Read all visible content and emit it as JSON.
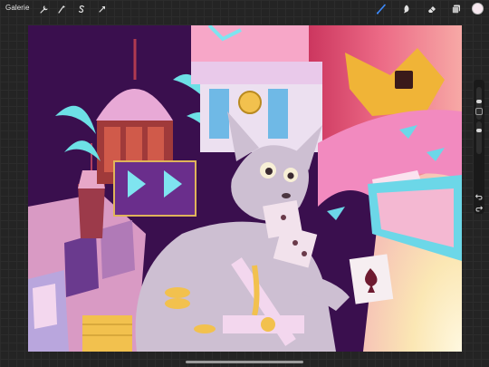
{
  "app": {
    "gallery_label": "Galerie"
  },
  "left_tools": [
    {
      "name": "wrench-icon"
    },
    {
      "name": "adjustments-wand-icon"
    },
    {
      "name": "selection-s-icon"
    },
    {
      "name": "transform-arrow-icon"
    }
  ],
  "right_tools": [
    {
      "name": "brush-icon",
      "active": true
    },
    {
      "name": "smudge-icon",
      "active": false
    },
    {
      "name": "eraser-icon",
      "active": false
    },
    {
      "name": "layers-icon",
      "active": false
    }
  ],
  "colors": {
    "active_tool": "#3d8bff",
    "current_color": "#f7e8ef"
  }
}
